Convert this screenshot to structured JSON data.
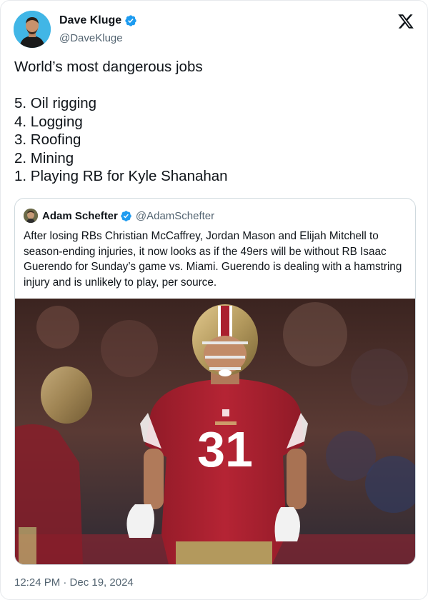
{
  "author": {
    "name": "Dave Kluge",
    "handle": "@DaveKluge"
  },
  "tweet": {
    "lines": [
      "World’s most dangerous jobs",
      "",
      "5. Oil rigging",
      "4. Logging",
      "3. Roofing",
      "2. Mining",
      "1. Playing RB for Kyle Shanahan"
    ]
  },
  "quoted": {
    "name": "Adam Schefter",
    "handle": "@AdamSchefter",
    "text": "After losing RBs Christian McCaffrey, Jordan Mason and Elijah Mitchell to season-ending injuries, it now looks as if the 49ers will be without RB Isaac Guerendo for Sunday’s game vs. Miami. Guerendo is dealing with a hamstring injury and is unlikely to play, per source.",
    "photo": {
      "jersey_number": "31"
    }
  },
  "timestamp": "12:24 PM · Dec 19, 2024",
  "colors": {
    "verified": "#1d9bf0",
    "jersey_red": "#aa1f2e",
    "helmet_gold": "#b3995d",
    "text_secondary": "#536471"
  }
}
